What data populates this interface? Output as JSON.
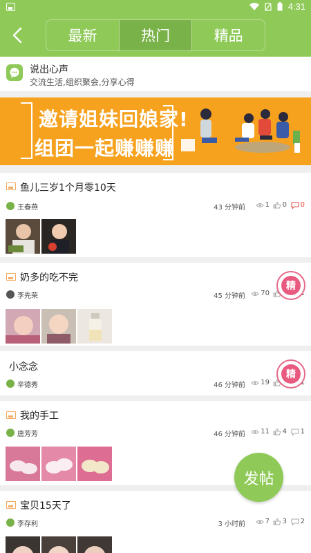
{
  "status_bar": {
    "time": "4:31"
  },
  "header": {
    "tabs": [
      {
        "label": "最新",
        "active": false
      },
      {
        "label": "热门",
        "active": true
      },
      {
        "label": "精品",
        "active": false
      }
    ]
  },
  "say": {
    "title": "说出心声",
    "subtitle": "交流生活,组织聚会,分享心得"
  },
  "banner": {
    "line1": "邀请姐妹回娘家!",
    "line2": "组团一起赚赚赚"
  },
  "posts": [
    {
      "title": "鱼儿三岁1个月零10天",
      "author": "王春燕",
      "time": "43 分钟前",
      "views": "1",
      "likes": "0",
      "comments": "0",
      "featured": false
    },
    {
      "title": "奶多的吃不完",
      "author": "李先荣",
      "time": "45 分钟前",
      "views": "70",
      "likes": "1",
      "comments": "1",
      "featured": true
    },
    {
      "title": "小念念",
      "author": "辛德秀",
      "time": "46 分钟前",
      "views": "19",
      "likes": "1",
      "comments": "1",
      "featured": true
    },
    {
      "title": "我的手工",
      "author": "唐芳芳",
      "time": "46 分钟前",
      "views": "11",
      "likes": "4",
      "comments": "1",
      "featured": false
    },
    {
      "title": "宝贝15天了",
      "author": "李存利",
      "time": "3 小时前",
      "views": "7",
      "likes": "3",
      "comments": "2",
      "featured": false
    }
  ],
  "stamp_label": "精",
  "fab_label": "发帖",
  "colors": {
    "primary": "#8fca58",
    "banner": "#f7a21f",
    "stamp": "#e95a80"
  }
}
